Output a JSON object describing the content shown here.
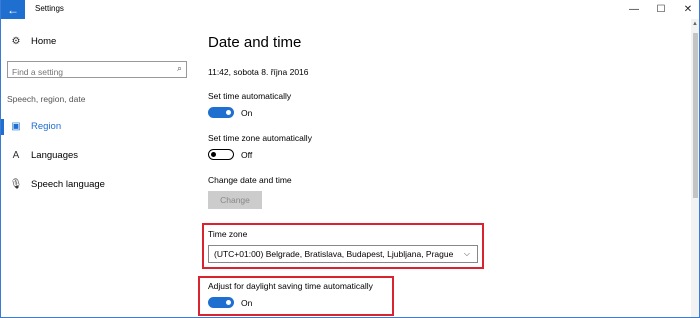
{
  "window": {
    "title": "Settings",
    "back_glyph": "←",
    "min_glyph": "—",
    "max_glyph": "☐",
    "close_glyph": "✕"
  },
  "sidebar": {
    "home_label": "Home",
    "search_placeholder": "Find a setting",
    "section_label": "Speech, region, date",
    "items": [
      {
        "label": "Region",
        "icon": "region-icon",
        "active": true
      },
      {
        "label": "Languages",
        "icon": "languages-icon",
        "active": false
      },
      {
        "label": "Speech language",
        "icon": "microphone-icon",
        "active": false
      }
    ]
  },
  "main": {
    "title": "Date and time",
    "current_datetime": "11:42, sobota 8. října 2016",
    "set_time_auto": {
      "label": "Set time automatically",
      "state": "On"
    },
    "set_timezone_auto": {
      "label": "Set time zone automatically",
      "state": "Off"
    },
    "change_datetime": {
      "label": "Change date and time",
      "button": "Change"
    },
    "time_zone": {
      "label": "Time zone",
      "value": "(UTC+01:00) Belgrade, Bratislava, Budapest, Ljubljana, Prague"
    },
    "dst_auto": {
      "label": "Adjust for daylight saving time automatically",
      "state": "On"
    }
  },
  "colors": {
    "accent": "#1f6fd0",
    "highlight_border": "#d9232e"
  }
}
